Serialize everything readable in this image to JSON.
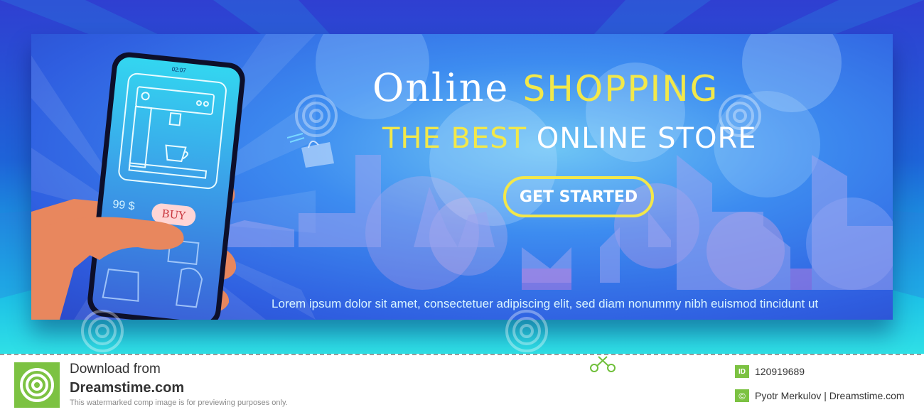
{
  "banner": {
    "title_part1": "Online",
    "title_part2": "SHOPPING",
    "subtitle_part1": "THE BEST",
    "subtitle_part2": "ONLINE STORE",
    "cta_label": "GET STARTED",
    "lorem": "Lorem ipsum dolor sit amet, consectetuer adipiscing elit, sed diam nonummy nibh euismod tincidunt ut",
    "colors": {
      "accent_yellow": "#f2e84a",
      "bg_blue": "#2f5ee0",
      "teal": "#2fe0e6"
    }
  },
  "phone": {
    "status_time": "02:07",
    "price": "99 $",
    "buy_label": "BUY",
    "screen_icons": [
      "coffee-machine-icon",
      "cake-icon",
      "kettle-icon"
    ]
  },
  "watermark": {
    "text": "dreamstime"
  },
  "footer": {
    "download_from": "Download from",
    "site": "Dreamstime.com",
    "note": "This watermarked comp image is for previewing purposes only.",
    "id_label": "ID",
    "image_id": "120919689",
    "copyright_symbol": "©",
    "author": "Pyotr Merkulov | Dreamstime.com"
  }
}
